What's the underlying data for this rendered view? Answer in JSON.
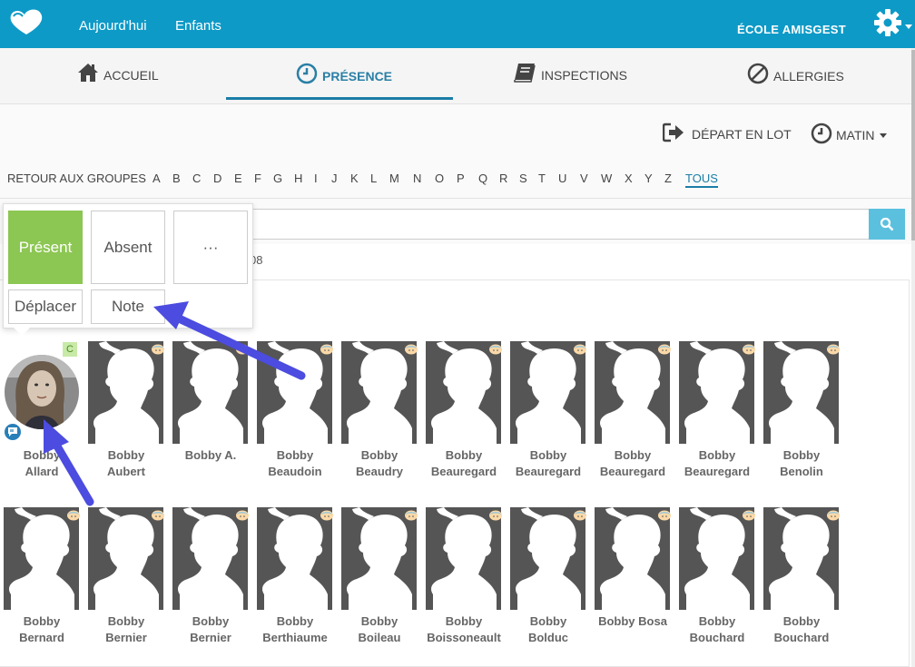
{
  "topbar": {
    "nav": [
      "Aujourd'hui",
      "Enfants"
    ],
    "school": "ÉCOLE AMISGEST",
    "icons": [
      "logo-heart-icon",
      "gear-icon"
    ]
  },
  "tabs": [
    {
      "label": "ACCUEIL",
      "icon": "home-icon"
    },
    {
      "label": "PRÉSENCE",
      "icon": "clock-icon",
      "active": true
    },
    {
      "label": "INSPECTIONS",
      "icon": "book-icon"
    },
    {
      "label": "ALLERGIES",
      "icon": "ban-icon"
    }
  ],
  "toolbar": {
    "depart": "DÉPART EN LOT",
    "period": "MATIN"
  },
  "alpha": {
    "back": "RETOUR AUX GROUPES",
    "letters": [
      "A",
      "B",
      "C",
      "D",
      "E",
      "F",
      "G",
      "H",
      "I",
      "J",
      "K",
      "L",
      "M",
      "N",
      "O",
      "P",
      "Q",
      "R",
      "S",
      "T",
      "U",
      "V",
      "W",
      "X",
      "Y",
      "Z"
    ],
    "all": "TOUS"
  },
  "search": {
    "placeholder": ""
  },
  "count_fragment": "08",
  "popover": {
    "present": "Présent",
    "absent": "Absent",
    "more": "···",
    "move": "Déplacer",
    "note": "Note"
  },
  "badge_c": "C",
  "children": [
    {
      "line1": "Bobby",
      "line2": "Allard",
      "photo": true
    },
    {
      "line1": "Bobby",
      "line2": "Aubert"
    },
    {
      "line1": "Bobby A.",
      "line2": ""
    },
    {
      "line1": "Bobby",
      "line2": "Beaudoin"
    },
    {
      "line1": "Bobby",
      "line2": "Beaudry"
    },
    {
      "line1": "Bobby",
      "line2": "Beauregard"
    },
    {
      "line1": "Bobby",
      "line2": "Beauregard"
    },
    {
      "line1": "Bobby",
      "line2": "Beauregard"
    },
    {
      "line1": "Bobby",
      "line2": "Beauregard"
    },
    {
      "line1": "Bobby",
      "line2": "Benolin"
    },
    {
      "line1": "Bobby",
      "line2": "Bernard"
    },
    {
      "line1": "Bobby",
      "line2": "Bernier"
    },
    {
      "line1": "Bobby",
      "line2": "Bernier"
    },
    {
      "line1": "Bobby",
      "line2": "Berthiaume"
    },
    {
      "line1": "Bobby",
      "line2": "Boileau"
    },
    {
      "line1": "Bobby",
      "line2": "Boissoneault"
    },
    {
      "line1": "Bobby",
      "line2": "Bolduc"
    },
    {
      "line1": "Bobby Bosa",
      "line2": ""
    },
    {
      "line1": "Bobby",
      "line2": "Bouchard"
    },
    {
      "line1": "Bobby",
      "line2": "Bouchard"
    }
  ],
  "colors": {
    "topbar": "#0e9ac7",
    "present": "#8cc653",
    "accent": "#1a7da6",
    "arrow": "#4c4ce0"
  }
}
